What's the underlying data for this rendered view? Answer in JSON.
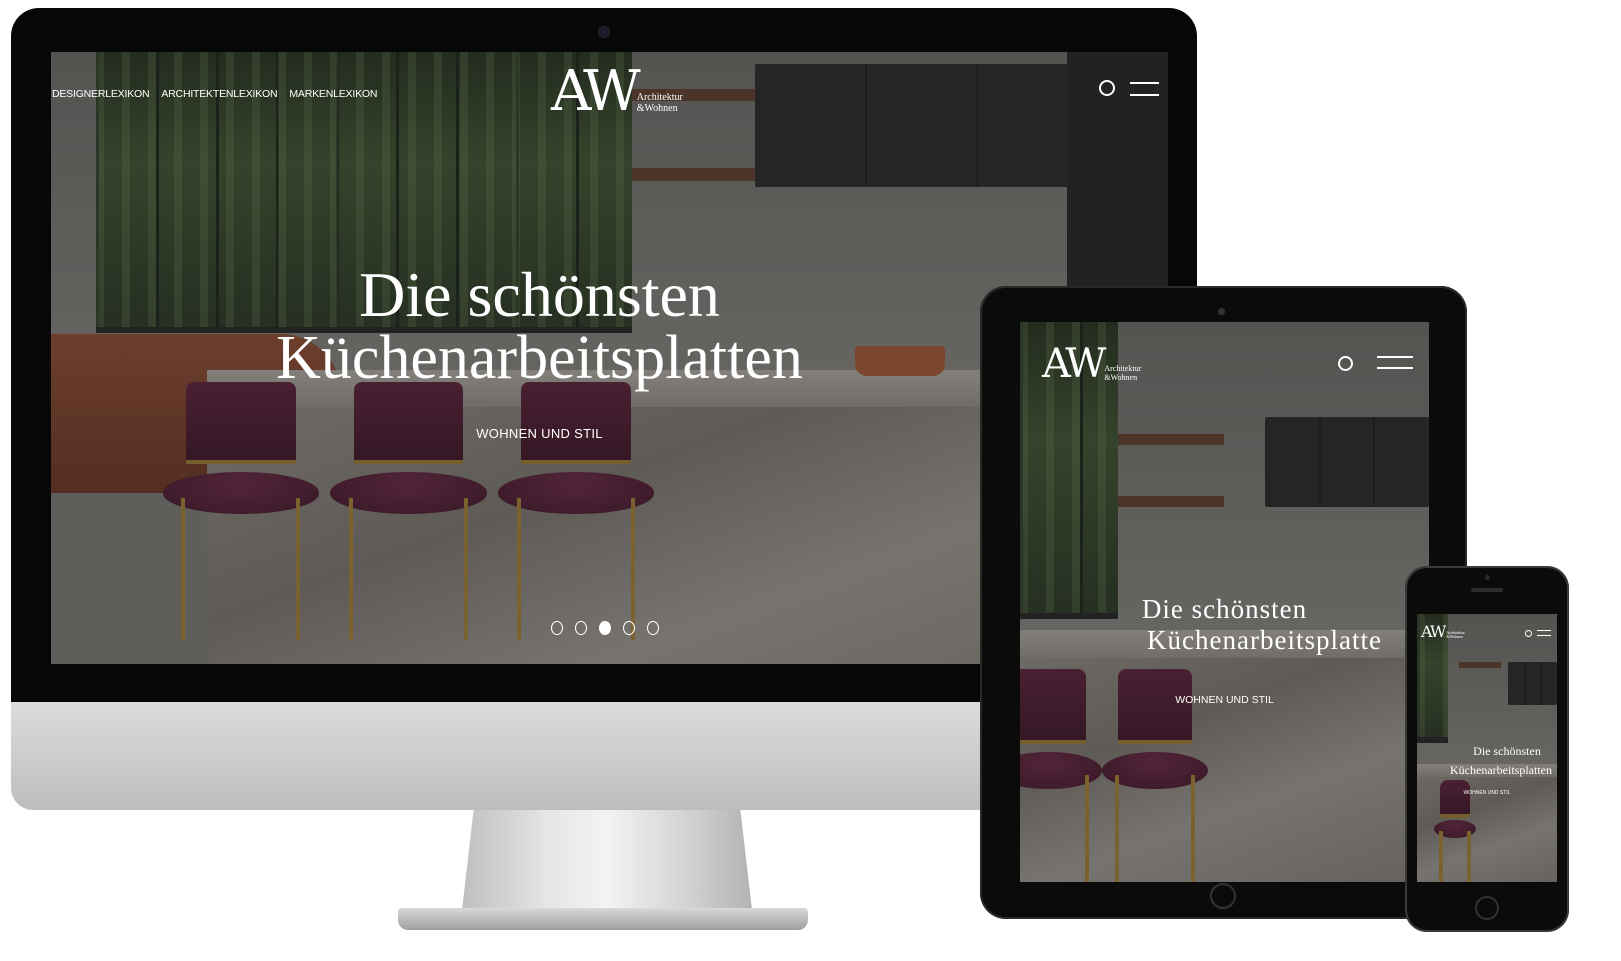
{
  "desktop": {
    "nav": [
      "DESIGNERLEXIKON",
      "ARCHITEKTENLEXIKON",
      "MARKENLEXIKON"
    ],
    "logo": {
      "mark": "AW",
      "sub_line1": "Architektur",
      "sub_line2": "&Wohnen"
    },
    "title_line1": "Die schönsten",
    "title_line2": "Küchenarbeitsplatten",
    "kicker": "WOHNEN UND STIL",
    "slider": {
      "count": 5,
      "active": 3
    }
  },
  "tablet": {
    "logo": {
      "mark": "AW",
      "sub_line1": "Architektur",
      "sub_line2": "&Wohnen"
    },
    "title_line1": "Die schönsten",
    "title_line2": "Küchenarbeitsplatte",
    "kicker": "WOHNEN UND STIL"
  },
  "phone": {
    "logo": {
      "mark": "AW",
      "sub_line1": "Architektur",
      "sub_line2": "&Wohnen"
    },
    "title_line1": "Die schönsten",
    "title_line2": "Küchenarbeitsplatten",
    "kicker": "WOHNEN UND STIL"
  }
}
